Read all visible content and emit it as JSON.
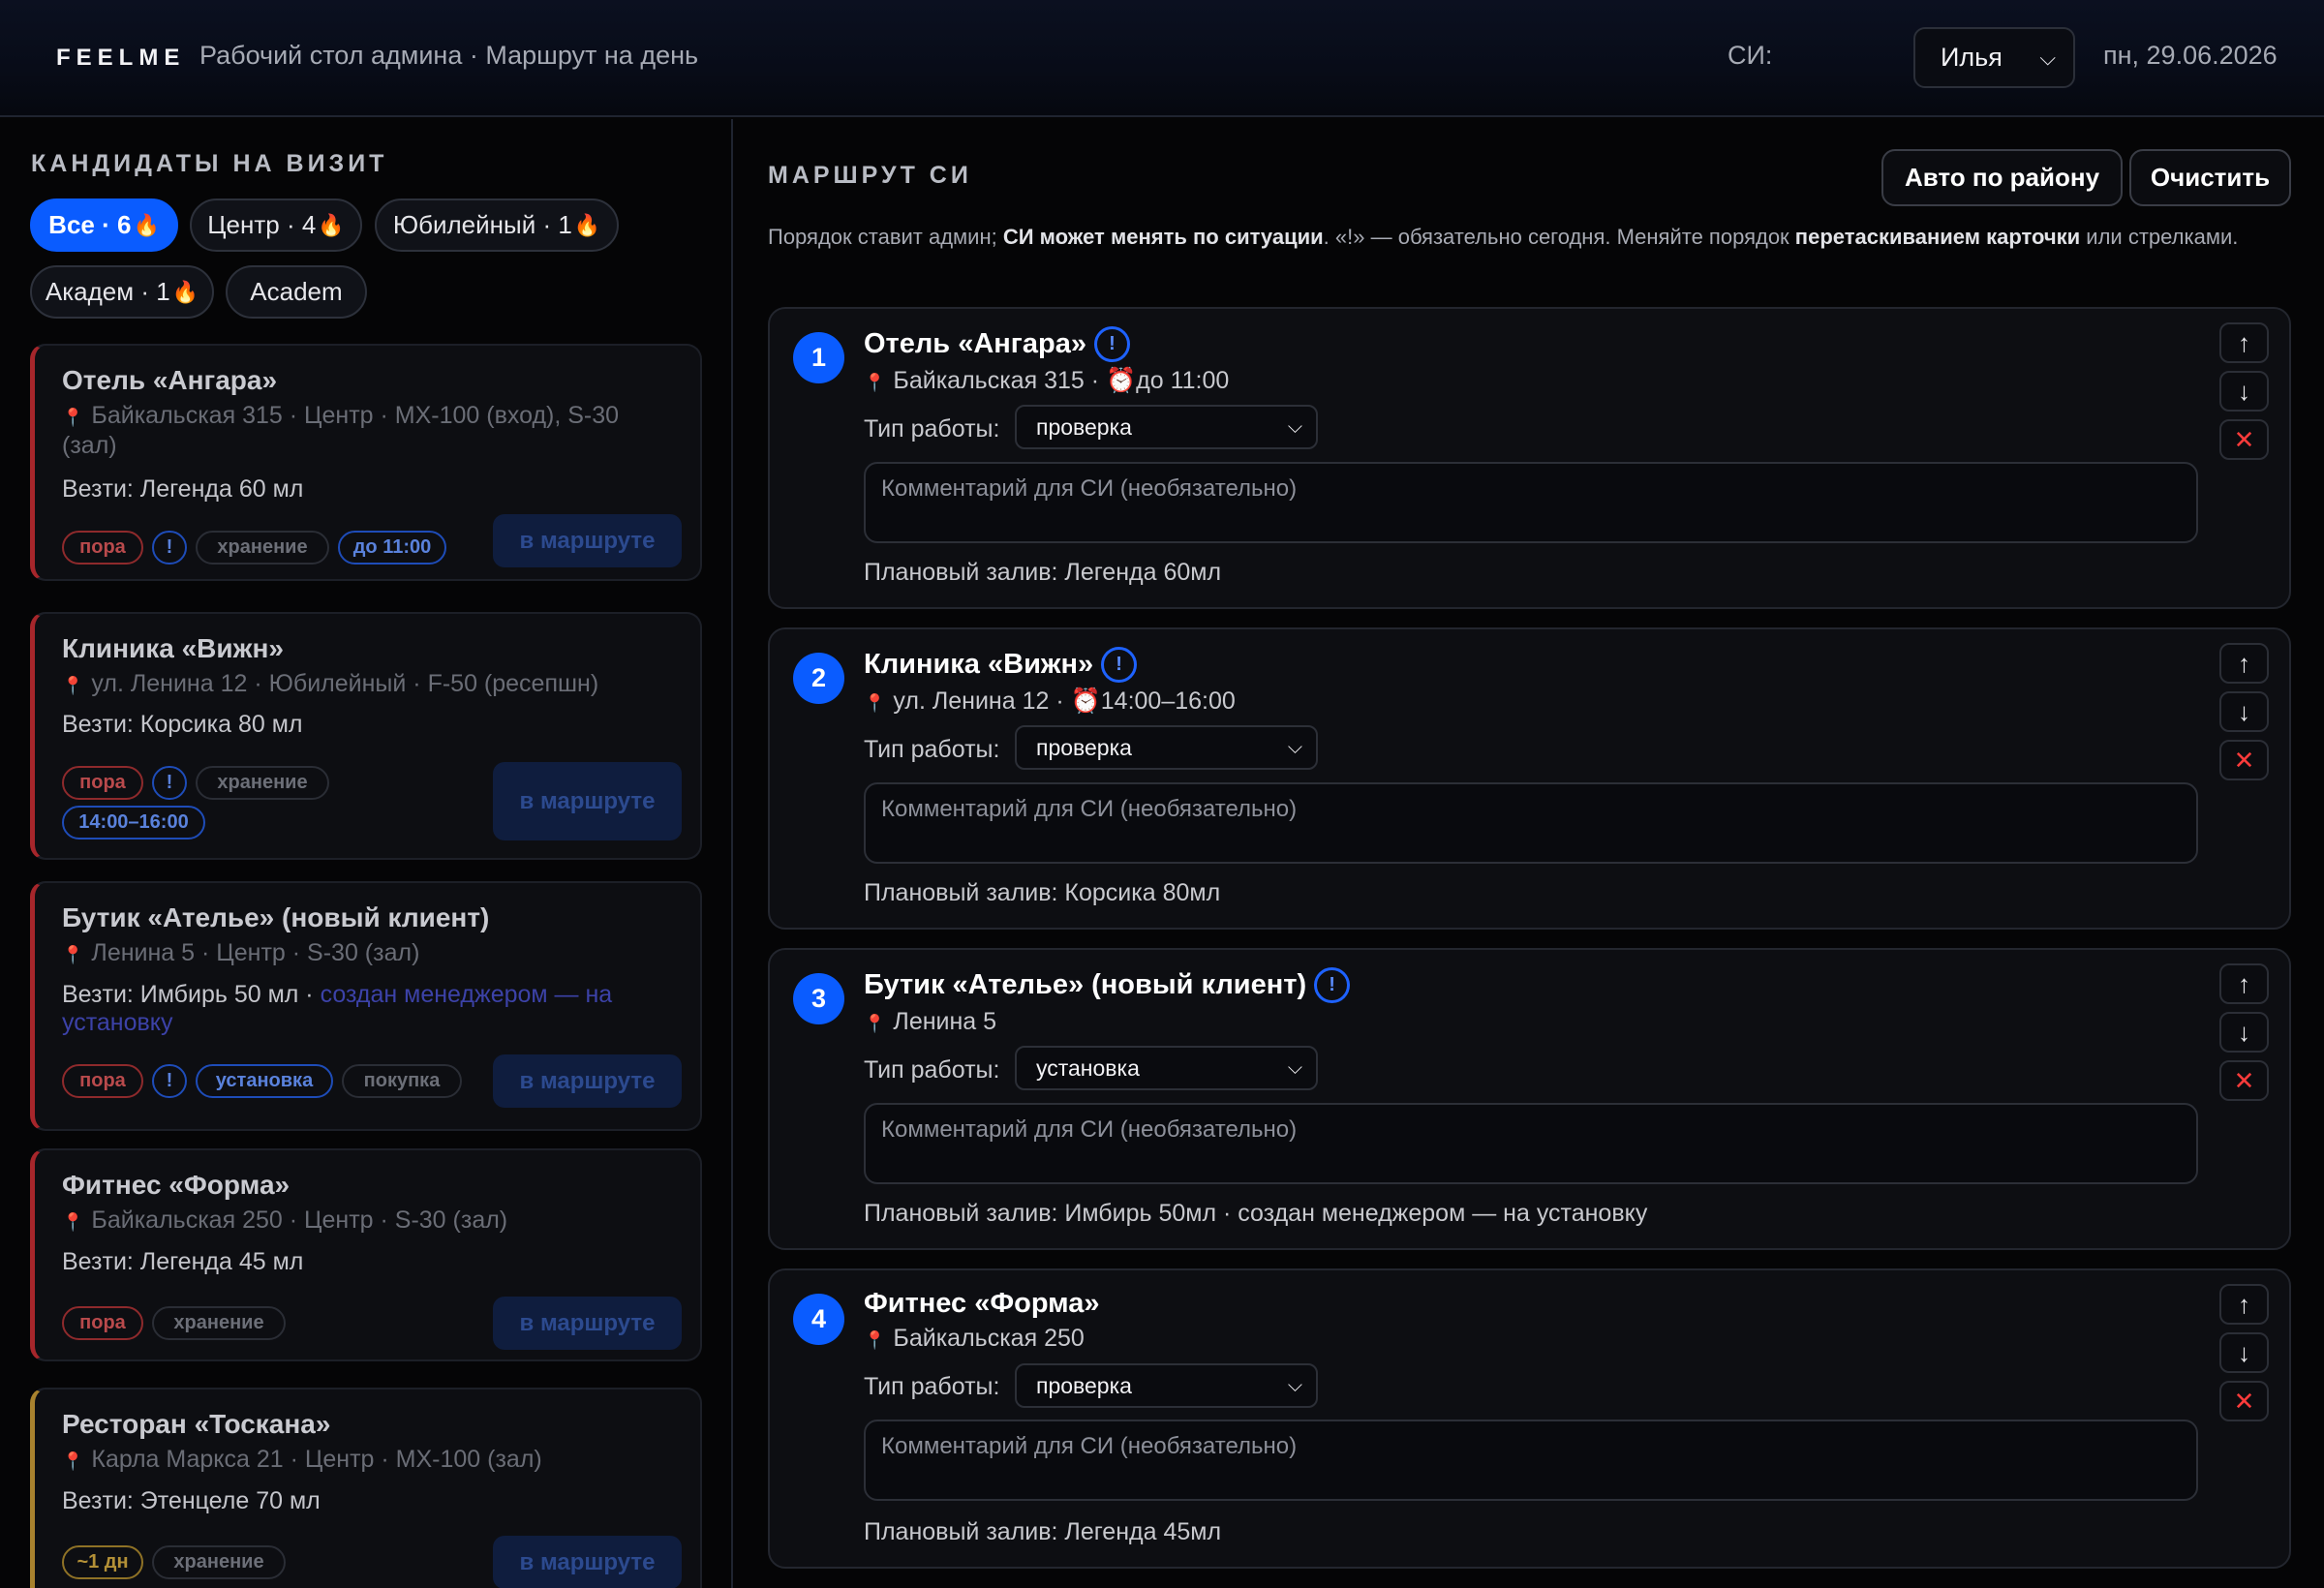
{
  "header": {
    "logo": "FEELME",
    "breadcrumb": "Рабочий стол админа · Маршрут на день",
    "si_label": "СИ:",
    "si_selected": "Илья",
    "date": "пн, 29.06.2026"
  },
  "candidates": {
    "title": "КАНДИДАТЫ НА ВИЗИТ",
    "filters": [
      {
        "label": "Все · 6",
        "fire": "🔥",
        "active": true
      },
      {
        "label": "Центр · 4",
        "fire": "🔥"
      },
      {
        "label": "Юбилейный · 1",
        "fire": "🔥"
      },
      {
        "label": "Академ · 1",
        "fire": "🔥"
      },
      {
        "label": "Academ",
        "fire": ""
      }
    ],
    "items": [
      {
        "name": "Отель «Ангара»",
        "address": "Байкальская 315 · Центр · MX-100 (вход), S-30 (зал)",
        "bring": "Везти: Легенда 60 мл",
        "tags": [
          "пора",
          "!",
          "хранение",
          "до 11:00"
        ],
        "button": "в маршруте"
      },
      {
        "name": "Клиника «Вижн»",
        "address": "ул. Ленина 12 · Юбилейный · F-50 (ресепшн)",
        "bring": "Везти: Корсика 80 мл",
        "tags": [
          "пора",
          "!",
          "хранение",
          "14:00–16:00"
        ],
        "button": "в маршруте"
      },
      {
        "name": "Бутик «Ателье» (новый клиент)",
        "address": "Ленина 5 · Центр · S-30 (зал)",
        "bring": "Везти: Имбирь 50 мл · ",
        "bring_note": "создан менеджером — на установку",
        "tags": [
          "пора",
          "!",
          "установка",
          "покупка"
        ],
        "button": "в маршруте"
      },
      {
        "name": "Фитнес «Форма»",
        "address": "Байкальская 250 · Центр · S-30 (зал)",
        "bring": "Везти: Легенда 45 мл",
        "tags": [
          "пора",
          "хранение"
        ],
        "button": "в маршруте"
      },
      {
        "name": "Ресторан «Тоскана»",
        "address": "Карла Маркса 21 · Центр · MX-100 (зал)",
        "bring": "Везти: Этенцеле 70 мл",
        "tags": [
          "~1 дн",
          "хранение"
        ],
        "button": "в маршруте"
      }
    ]
  },
  "route": {
    "title": "МАРШРУТ СИ",
    "auto_button": "Авто по району",
    "clear_button": "Очистить",
    "hint_a": "Порядок ставит админ; ",
    "hint_b": "СИ может менять по ситуации",
    "hint_c": ". «!» — обязательно сегодня. Меняйте порядок ",
    "hint_d": "перетаскиванием карточки",
    "hint_e": " или стрелками.",
    "work_label": "Тип работы:",
    "comment_placeholder": "Комментарий для СИ (необязательно)",
    "stops": [
      {
        "num": "1",
        "name": "Отель «Ангара»",
        "bang": "!",
        "address": "Байкальская 315 · ",
        "time": "до 11:00",
        "work": "проверка",
        "plan": "Плановый залив: Легенда 60мл"
      },
      {
        "num": "2",
        "name": "Клиника «Вижн»",
        "bang": "!",
        "address": "ул. Ленина 12 · ",
        "time": "14:00–16:00",
        "work": "проверка",
        "plan": "Плановый залив: Корсика 80мл"
      },
      {
        "num": "3",
        "name": "Бутик «Ателье» (новый клиент)",
        "bang": "!",
        "address": "Ленина 5",
        "time": "",
        "work": "установка",
        "plan": "Плановый залив: Имбирь 50мл · создан менеджером — на установку"
      },
      {
        "num": "4",
        "name": "Фитнес «Форма»",
        "bang": "",
        "address": "Байкальская 250",
        "time": "",
        "work": "проверка",
        "plan": "Плановый залив: Легенда 45мл"
      }
    ]
  }
}
